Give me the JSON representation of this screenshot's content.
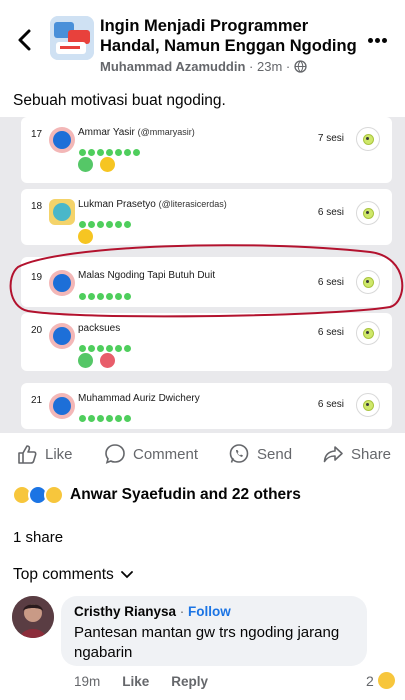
{
  "header": {
    "group_title": "Ingin Menjadi Programmer Handal, Namun Enggan Ngoding",
    "author": "Muhammad Azamuddin",
    "time": "23m"
  },
  "post": {
    "text": "Sebuah motivasi buat ngoding."
  },
  "leaderboard": {
    "rows": [
      {
        "rank": "17",
        "name": "Ammar Yasir",
        "handle": "(@mmaryasir)",
        "sessions": "7 sesi"
      },
      {
        "rank": "18",
        "name": "Lukman Prasetyo",
        "handle": "(@literasicerdas)",
        "sessions": "6 sesi"
      },
      {
        "rank": "19",
        "name": "Malas Ngoding Tapi Butuh Duit",
        "handle": "",
        "sessions": "6 sesi"
      },
      {
        "rank": "20",
        "name": "packsues",
        "handle": "",
        "sessions": "6 sesi"
      },
      {
        "rank": "21",
        "name": "Muhammad Auriz Dwichery",
        "handle": "",
        "sessions": "6 sesi"
      }
    ],
    "highlight_color": "#b3122e"
  },
  "actions": {
    "like": "Like",
    "comment": "Comment",
    "send": "Send",
    "share": "Share"
  },
  "reactions": {
    "text": "Anwar Syaefudin and 22 others"
  },
  "shares": "1 share",
  "comments_filter": "Top comments",
  "comment": {
    "author": "Cristhy Rianysa",
    "separator": " · ",
    "follow": "Follow",
    "text": "Pantesan mantan gw trs ngoding jarang ngabarin",
    "time": "19m",
    "like": "Like",
    "reply": "Reply",
    "reaction_count": "2"
  },
  "colors": {
    "accent": "#1b74e4",
    "muted": "#65676b",
    "progress_dot": "#4fce5d"
  }
}
